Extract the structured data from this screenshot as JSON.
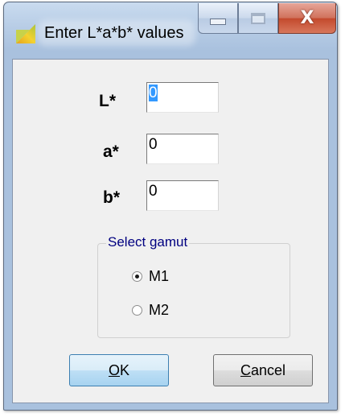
{
  "window": {
    "title": "Enter L*a*b* values",
    "close_glyph": "X"
  },
  "fields": [
    {
      "label": "L*",
      "value": "0",
      "focused": true
    },
    {
      "label": "a*",
      "value": "0",
      "focused": false
    },
    {
      "label": "b*",
      "value": "0",
      "focused": false
    }
  ],
  "gamut": {
    "title": "Select gamut",
    "options": [
      {
        "label": "M1",
        "selected": true
      },
      {
        "label": "M2",
        "selected": false
      }
    ]
  },
  "buttons": {
    "ok_mnemonic": "O",
    "ok_rest": "K",
    "cancel_mnemonic": "C",
    "cancel_rest": "ancel"
  },
  "colors": {
    "titlebar": "#b8cde6",
    "client": "#f0f0f0",
    "group_title": "#000080",
    "selection": "#3399ff",
    "close_button": "#c3492c"
  }
}
